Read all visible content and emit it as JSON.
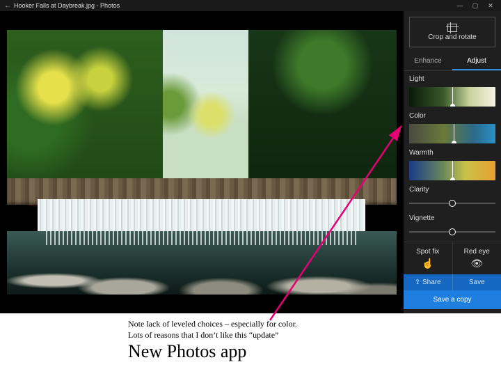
{
  "titlebar": {
    "back_icon": "←",
    "title": "Hooker Falls at Daybreak.jpg - Photos",
    "min": "—",
    "max": "▢",
    "close": "✕"
  },
  "panel": {
    "crop_label": "Crop and rotate",
    "tabs": {
      "enhance": "Enhance",
      "adjust": "Adjust"
    },
    "light": {
      "label": "Light",
      "handle_pct": 50
    },
    "color": {
      "label": "Color",
      "handle_pct": 52
    },
    "warmth": {
      "label": "Warmth",
      "handle_pct": 50
    },
    "clarity": {
      "label": "Clarity",
      "value_pct": 50
    },
    "vignette": {
      "label": "Vignette",
      "value_pct": 50
    },
    "spotfix": "Spot fix",
    "redeye": "Red eye",
    "share": "Share",
    "share_icon": "⇪",
    "save": "Save",
    "savecopy": "Save a copy"
  },
  "annotation": {
    "line1": "Note lack of leveled choices – especially for color.",
    "line2": "Lots of reasons that I don’t like this “update”",
    "headline": "New Photos app",
    "arrow_color": "#e60073"
  }
}
